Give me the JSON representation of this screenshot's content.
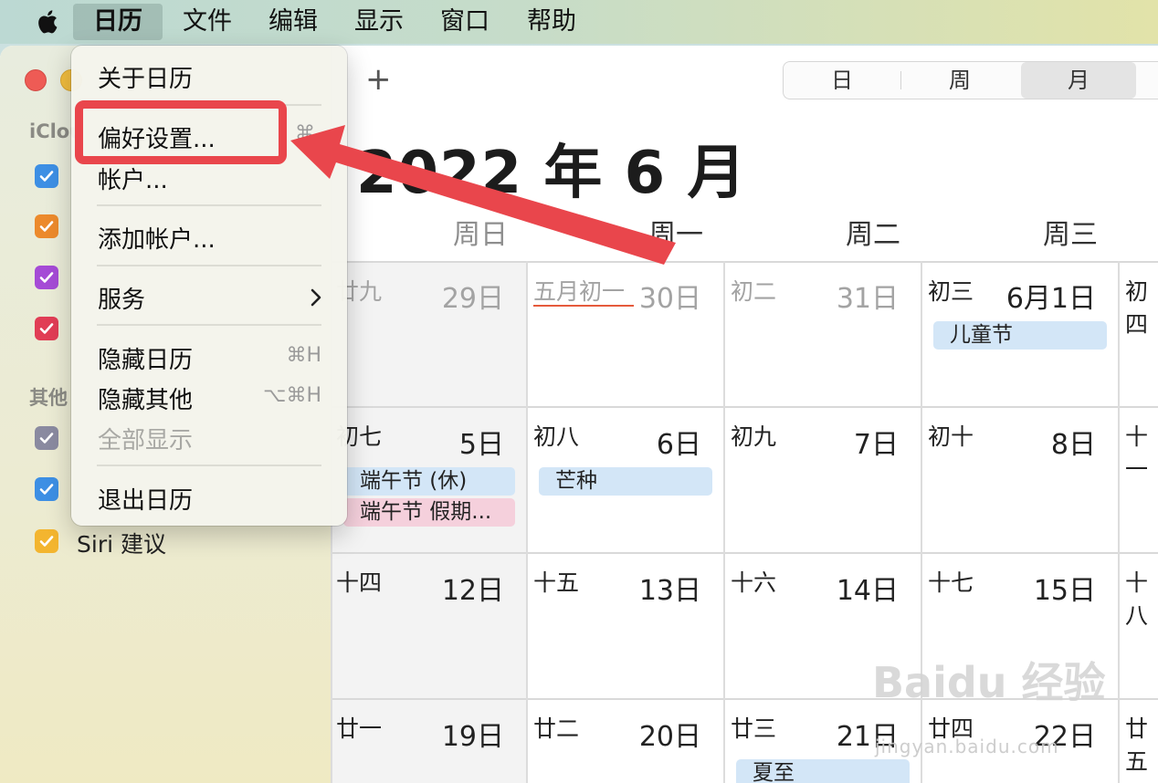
{
  "menubar": {
    "items": [
      {
        "label": "日历"
      },
      {
        "label": "文件"
      },
      {
        "label": "编辑"
      },
      {
        "label": "显示"
      },
      {
        "label": "窗口"
      },
      {
        "label": "帮助"
      }
    ]
  },
  "toolbar": {
    "add_label": "+",
    "views": [
      {
        "label": "日"
      },
      {
        "label": "周"
      },
      {
        "label": "月"
      }
    ],
    "selected_view": "月"
  },
  "sidebar": {
    "section_icloud": "iClou",
    "section_other": "其他",
    "siri_label": "Siri 建议",
    "calendars": [
      {
        "color": "#3d8fe4"
      },
      {
        "color": "#ec8a2c"
      },
      {
        "color": "#a54bd6"
      },
      {
        "color": "#e13d55"
      },
      {
        "color": "#8a8aa0"
      },
      {
        "color": "#3d8fe4"
      },
      {
        "color": "#f3b52f"
      }
    ]
  },
  "calendar": {
    "title": "2022 年 6 月",
    "weekdays": [
      "周日",
      "周一",
      "周二",
      "周三"
    ],
    "weeks": [
      [
        {
          "lunar": "廿九",
          "day": "29日",
          "dim": true
        },
        {
          "lunar": "五月初一",
          "day": "30日",
          "dim": true
        },
        {
          "lunar": "初二",
          "day": "31日",
          "dim": true
        },
        {
          "lunar": "初三",
          "day": "6月1日",
          "dim": false
        },
        {
          "lunar": "初四",
          "day": "",
          "dim": false
        }
      ],
      [
        {
          "lunar": "初七",
          "day": "5日"
        },
        {
          "lunar": "初八",
          "day": "6日"
        },
        {
          "lunar": "初九",
          "day": "7日"
        },
        {
          "lunar": "初十",
          "day": "8日"
        },
        {
          "lunar": "十一",
          "day": ""
        }
      ],
      [
        {
          "lunar": "十四",
          "day": "12日"
        },
        {
          "lunar": "十五",
          "day": "13日"
        },
        {
          "lunar": "十六",
          "day": "14日"
        },
        {
          "lunar": "十七",
          "day": "15日"
        },
        {
          "lunar": "十八",
          "day": ""
        }
      ],
      [
        {
          "lunar": "廿一",
          "day": "19日"
        },
        {
          "lunar": "廿二",
          "day": "20日"
        },
        {
          "lunar": "廿三",
          "day": "21日"
        },
        {
          "lunar": "廿四",
          "day": "22日"
        },
        {
          "lunar": "廿五",
          "day": ""
        }
      ]
    ],
    "events": {
      "childrens_day": "儿童节",
      "dragon_boat_rest": "端午节 (休)",
      "dragon_boat_holiday": "端午节 假期...",
      "grain_in_ear": "芒种",
      "summer_solstice": "夏至"
    }
  },
  "dropdown": {
    "about": "关于日历",
    "preferences": "偏好设置...",
    "preferences_shortcut": "⌘,",
    "accounts": "帐户...",
    "add_account": "添加帐户...",
    "services": "服务",
    "hide_calendar": "隐藏日历",
    "hide_calendar_shortcut": "⌘H",
    "hide_others": "隐藏其他",
    "hide_others_shortcut": "⌥⌘H",
    "show_all": "全部显示",
    "quit": "退出日历"
  },
  "watermark": {
    "text": "Baidu 经验",
    "url": "jingyan.baidu.com"
  },
  "colors": {
    "annotation_red": "#e9464c",
    "event_blue": "#d3e6f7",
    "event_pink": "#f5d0dc",
    "today_red": "#e55a3c"
  }
}
